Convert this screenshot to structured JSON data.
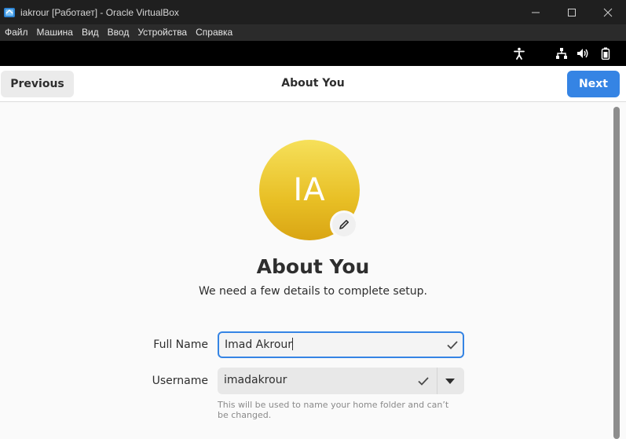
{
  "window": {
    "title": "iakrour [Работает] - Oracle VirtualBox",
    "controls": [
      "minimize-icon",
      "maximize-icon",
      "close-icon"
    ]
  },
  "menubar": {
    "items": [
      "Файл",
      "Машина",
      "Вид",
      "Ввод",
      "Устройства",
      "Справка"
    ]
  },
  "guest_panel": {
    "icons": [
      "accessibility-icon",
      "network-icon",
      "volume-icon",
      "battery-icon"
    ]
  },
  "header": {
    "previous_label": "Previous",
    "title": "About You",
    "next_label": "Next"
  },
  "main": {
    "avatar_initials": "IA",
    "heading": "About You",
    "subtitle": "We need a few details to complete setup.",
    "full_name": {
      "label": "Full Name",
      "value": "Imad Akrour"
    },
    "username": {
      "label": "Username",
      "value": "imadakrour",
      "hint": "This will be used to name your home folder and can’t be changed."
    }
  },
  "colors": {
    "accent": "#3584e4",
    "avatar_top": "#f6e05a",
    "avatar_bottom": "#d9a514",
    "titlebar": "#1f1f1f",
    "menubar": "#2b2b2b"
  }
}
